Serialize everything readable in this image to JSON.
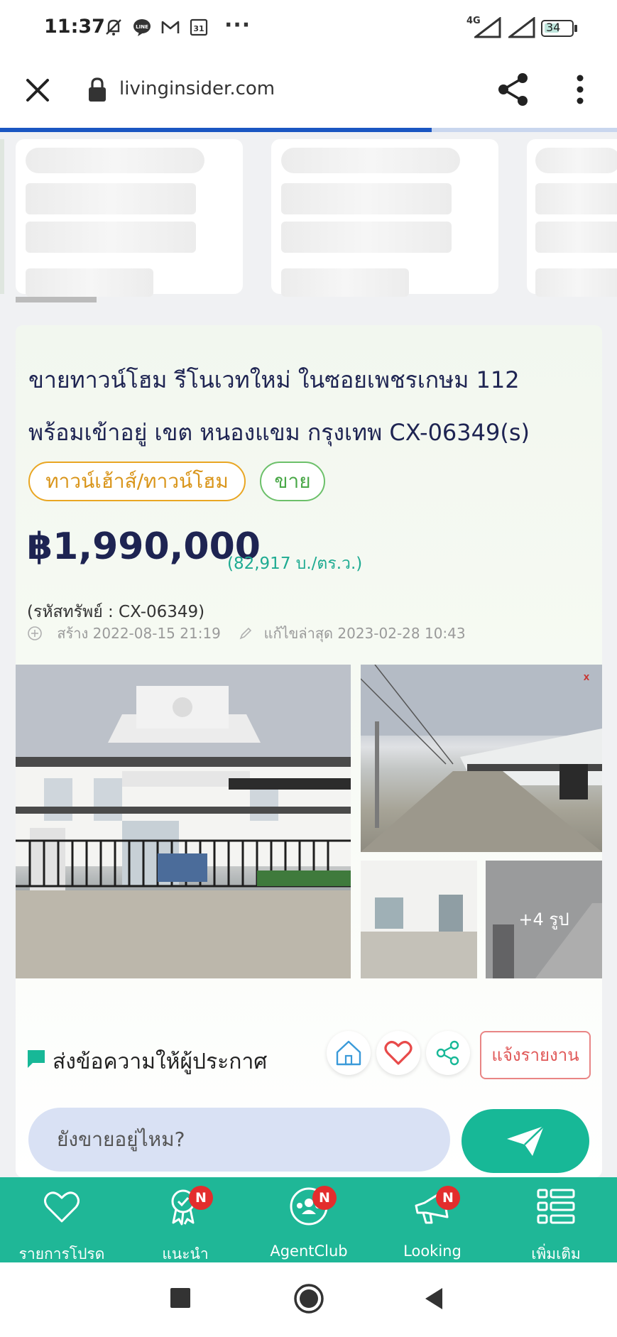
{
  "status_bar": {
    "time": "11:37",
    "icons": [
      "mute-bell-icon",
      "line-app-icon",
      "gmail-icon",
      "calendar-icon"
    ],
    "calendar_day": "31",
    "more": "···",
    "network": "4G",
    "battery": "34"
  },
  "browser": {
    "url": "livinginsider.com",
    "load_progress": 0.7
  },
  "listing": {
    "title_line1": "ขายทาวน์โฮม รีโนเวทใหม่ ในซอยเพชรเกษม 112",
    "title_line2": "พร้อมเข้าอยู่ เขต หนองแขม กรุงเทพ CX-06349(s)",
    "tag_type": "ทาวน์เฮ้าส์/ทาวน์โฮม",
    "tag_sale": "ขาย",
    "price": "฿1,990,000",
    "price_per_area": "(82,917 บ./ตร.ว.)",
    "property_code": "(รหัสทรัพย์ : CX-06349)",
    "created_label": "สร้าง 2022-08-15 21:19",
    "edited_label": "แก้ไขล่าสุด 2023-02-28 10:43",
    "more_photos": "+4 รูป",
    "contact_label": "ส่งข้อความให้ผู้ประกาศ",
    "report_label": "แจ้งรายงาน",
    "message_placeholder": "ยังขายอยู่ไหม?"
  },
  "bottom_nav": {
    "items": [
      {
        "label": "รายการโปรด",
        "icon": "heart-icon",
        "badge": ""
      },
      {
        "label": "แนะนำ",
        "icon": "award-icon",
        "badge": "N"
      },
      {
        "label": "AgentClub",
        "icon": "group-icon",
        "badge": "N"
      },
      {
        "label": "Looking",
        "icon": "megaphone-icon",
        "badge": "N"
      },
      {
        "label": "เพิ่มเติม",
        "icon": "menu-list-icon",
        "badge": ""
      }
    ]
  },
  "colors": {
    "brand_green": "#1fb797",
    "title_navy": "#1e2452",
    "tag_orange": "#e9a623",
    "tag_green": "#6cc06a",
    "badge_red": "#e32d2d",
    "progress_blue": "#1a56c2"
  }
}
